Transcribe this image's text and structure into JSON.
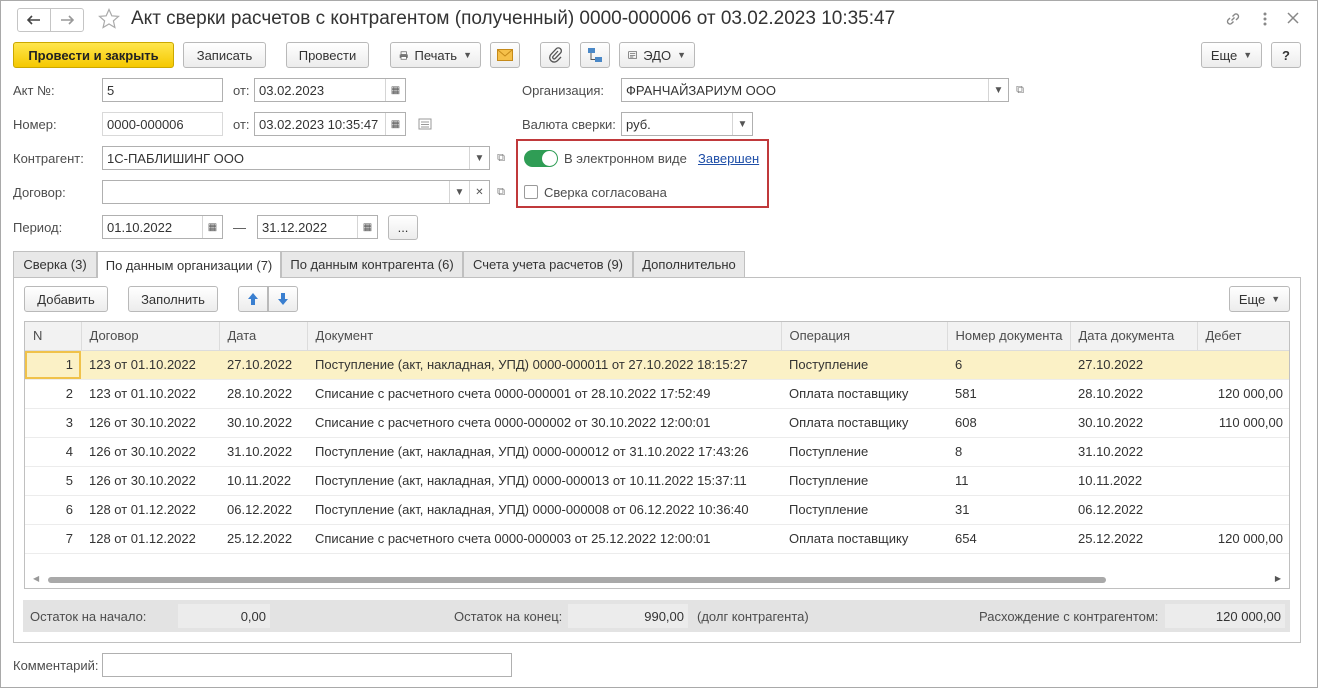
{
  "window": {
    "title": "Акт сверки расчетов с контрагентом (полученный) 0000-000006 от 03.02.2023 10:35:47"
  },
  "toolbar": {
    "post_close_label": "Провести и закрыть",
    "save_label": "Записать",
    "post_label": "Провести",
    "print_label": "Печать",
    "edo_label": "ЭДО",
    "more_label": "Еще",
    "help_label": "?"
  },
  "form": {
    "act_no_label": "Акт №:",
    "act_no_value": "5",
    "from_label": "от:",
    "act_date_value": "03.02.2023",
    "number_label": "Номер:",
    "number_value": "0000-000006",
    "number_date_value": "03.02.2023 10:35:47",
    "counterparty_label": "Контрагент:",
    "counterparty_value": "1С-ПАБЛИШИНГ ООО",
    "contract_label": "Договор:",
    "contract_value": "",
    "period_label": "Период:",
    "period_start": "01.10.2022",
    "period_dash": "—",
    "period_end": "31.12.2022",
    "period_more": "...",
    "organization_label": "Организация:",
    "organization_value": "ФРАНЧАЙЗАРИУМ ООО",
    "currency_label": "Валюта сверки:",
    "currency_value": "руб.",
    "electronic_label": "В электронном виде",
    "electronic_on": true,
    "status_link": "Завершен",
    "agreed_label": "Сверка согласована",
    "agreed_checked": false
  },
  "tabs": [
    {
      "label": "Сверка (3)",
      "active": false
    },
    {
      "label": "По данным организации (7)",
      "active": true
    },
    {
      "label": "По данным контрагента (6)",
      "active": false
    },
    {
      "label": "Счета учета расчетов (9)",
      "active": false
    },
    {
      "label": "Дополнительно",
      "active": false
    }
  ],
  "table_toolbar": {
    "add_label": "Добавить",
    "fill_label": "Заполнить",
    "more_label": "Еще"
  },
  "table": {
    "columns": [
      "N",
      "Договор",
      "Дата",
      "Документ",
      "Операция",
      "Номер документа",
      "Дата документа",
      "Дебет"
    ],
    "rows": [
      [
        "1",
        "123 от 01.10.2022",
        "27.10.2022",
        "Поступление (акт, накладная, УПД) 0000-000011 от 27.10.2022 18:15:27",
        "Поступление",
        "6",
        "27.10.2022",
        ""
      ],
      [
        "2",
        "123 от 01.10.2022",
        "28.10.2022",
        "Списание с расчетного счета 0000-000001 от 28.10.2022 17:52:49",
        "Оплата поставщику",
        "581",
        "28.10.2022",
        "120 000,00"
      ],
      [
        "3",
        "126 от 30.10.2022",
        "30.10.2022",
        "Списание с расчетного счета 0000-000002 от 30.10.2022 12:00:01",
        "Оплата поставщику",
        "608",
        "30.10.2022",
        "110 000,00"
      ],
      [
        "4",
        "126 от 30.10.2022",
        "31.10.2022",
        "Поступление (акт, накладная, УПД) 0000-000012 от 31.10.2022 17:43:26",
        "Поступление",
        "8",
        "31.10.2022",
        ""
      ],
      [
        "5",
        "126 от 30.10.2022",
        "10.11.2022",
        "Поступление (акт, накладная, УПД) 0000-000013 от 10.11.2022 15:37:11",
        "Поступление",
        "11",
        "10.11.2022",
        ""
      ],
      [
        "6",
        "128 от 01.12.2022",
        "06.12.2022",
        "Поступление (акт, накладная, УПД) 0000-000008 от 06.12.2022 10:36:40",
        "Поступление",
        "31",
        "06.12.2022",
        ""
      ],
      [
        "7",
        "128 от 01.12.2022",
        "25.12.2022",
        "Списание с расчетного счета 0000-000003 от 25.12.2022 12:00:01",
        "Оплата поставщику",
        "654",
        "25.12.2022",
        "120 000,00"
      ]
    ],
    "selected_row": 0
  },
  "footer": {
    "start_balance_label": "Остаток на начало:",
    "start_balance_value": "0,00",
    "end_balance_label": "Остаток на конец:",
    "end_balance_value": "990,00",
    "end_balance_note": "(долг контрагента)",
    "discrepancy_label": "Расхождение с контрагентом:",
    "discrepancy_value": "120 000,00"
  },
  "comment": {
    "label": "Комментарий:",
    "value": ""
  },
  "colors": {
    "accent_yellow": "#f5c800",
    "toggle_green": "#2f9d55",
    "link_blue": "#1f4fa8",
    "highlight_red": "#c0393b",
    "selected_row": "#fbf1c6"
  }
}
